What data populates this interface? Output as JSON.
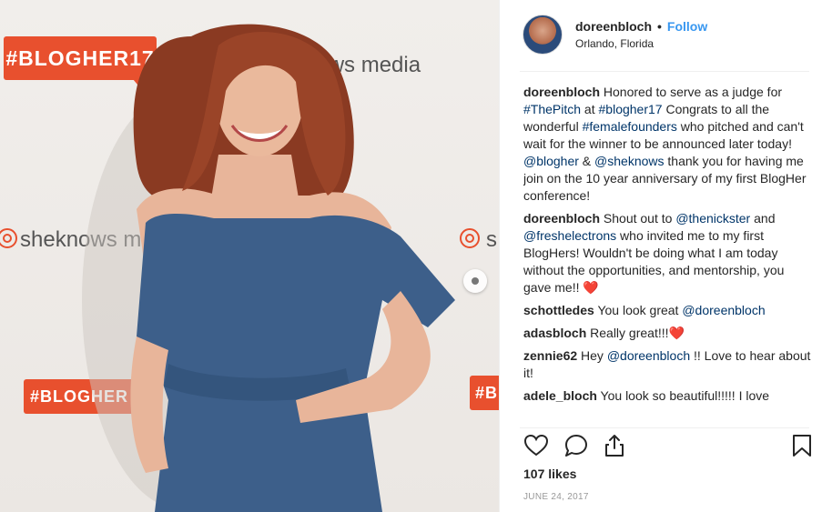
{
  "photo": {
    "banner_text": "#BLOGHER17",
    "banner_text_partial": "#BLOGHER",
    "banner_text_edge": "#B",
    "sponsor_text_1": "nows media",
    "sponsor_text_2": "sheknows m",
    "sponsor_text_3": "s",
    "sponsor_text_4": "ia",
    "carousel_icon": "next-arrow-icon"
  },
  "post": {
    "username": "doreenbloch",
    "separator": "•",
    "follow_label": "Follow",
    "location": "Orlando, Florida"
  },
  "comments": [
    {
      "user": "doreenbloch",
      "parts": [
        {
          "t": "text",
          "v": " Honored to serve as a judge for "
        },
        {
          "t": "link",
          "v": "#ThePitch"
        },
        {
          "t": "text",
          "v": " at "
        },
        {
          "t": "link",
          "v": "#blogher17"
        },
        {
          "t": "text",
          "v": " Congrats to all the wonderful "
        },
        {
          "t": "link",
          "v": "#femalefounders"
        },
        {
          "t": "text",
          "v": " who pitched and can't wait for the winner to be announced later today! "
        },
        {
          "t": "link",
          "v": "@blogher"
        },
        {
          "t": "text",
          "v": " & "
        },
        {
          "t": "link",
          "v": "@sheknows"
        },
        {
          "t": "text",
          "v": " thank you for having me join on the 10 year anniversary of my first BlogHer conference!"
        }
      ]
    },
    {
      "user": "doreenbloch",
      "parts": [
        {
          "t": "text",
          "v": " Shout out to "
        },
        {
          "t": "link",
          "v": "@thenickster"
        },
        {
          "t": "text",
          "v": " and "
        },
        {
          "t": "link",
          "v": "@freshelectrons"
        },
        {
          "t": "text",
          "v": " who invited me to my first BlogHers! Wouldn't be doing what I am today without the opportunities, and mentorship, you gave me!! ❤️"
        }
      ]
    },
    {
      "user": "schottledes",
      "parts": [
        {
          "t": "text",
          "v": " You look great "
        },
        {
          "t": "link",
          "v": "@doreenbloch"
        }
      ]
    },
    {
      "user": "adasbloch",
      "parts": [
        {
          "t": "text",
          "v": " Really great!!!❤️"
        }
      ]
    },
    {
      "user": "zennie62",
      "parts": [
        {
          "t": "text",
          "v": " Hey "
        },
        {
          "t": "link",
          "v": "@doreenbloch"
        },
        {
          "t": "text",
          "v": " !! Love to hear about it!"
        }
      ]
    },
    {
      "user": "adele_bloch",
      "parts": [
        {
          "t": "text",
          "v": " You look so beautiful!!!!! I love"
        }
      ]
    }
  ],
  "actions": {
    "like_icon": "heart-icon",
    "comment_icon": "comment-bubble-icon",
    "share_icon": "share-icon",
    "save_icon": "bookmark-icon"
  },
  "likes_text": "107 likes",
  "date_text": "JUNE 24, 2017",
  "colors": {
    "accent": "#3897f0",
    "link": "#003569",
    "banner": "#e8502e",
    "dress": "#3d5f8a"
  }
}
